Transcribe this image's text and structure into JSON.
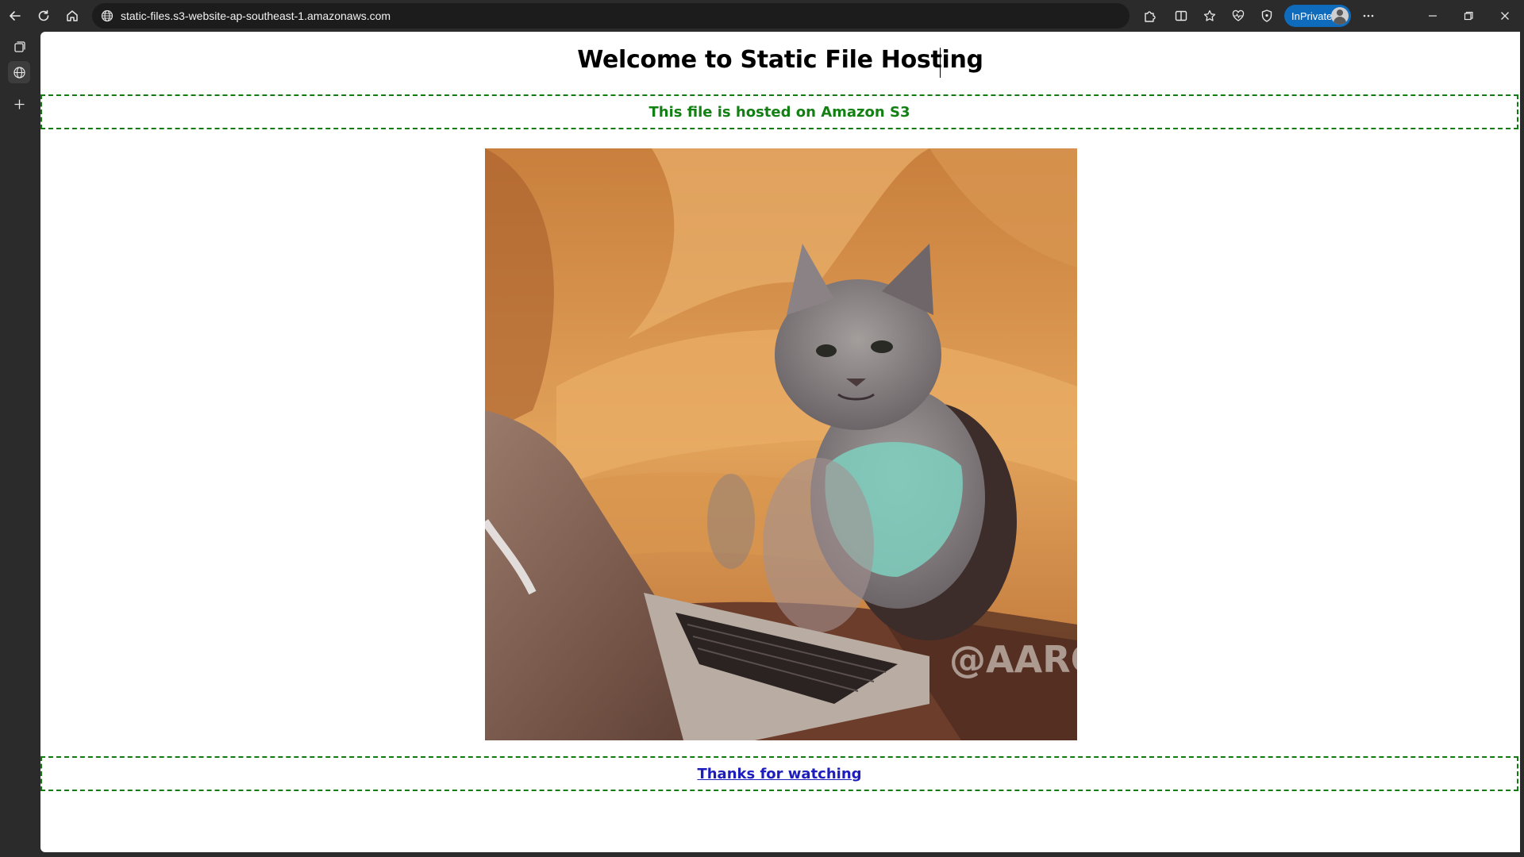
{
  "browser": {
    "url": "static-files.s3-website-ap-southeast-1.amazonaws.com",
    "inprivate_label": "InPrivate",
    "icons": {
      "back": "back-arrow-icon",
      "refresh": "refresh-icon",
      "home": "home-icon",
      "site_info": "globe-icon",
      "extensions": "puzzle-icon",
      "split_screen": "split-screen-icon",
      "favorites": "star-icon",
      "health": "heart-pulse-icon",
      "security": "shield-icon",
      "more": "ellipsis-icon",
      "minimize": "minimize-icon",
      "restore": "restore-icon",
      "close": "close-icon"
    }
  },
  "sidebar": {
    "icons": [
      "tab-actions-icon",
      "globe-tab-icon",
      "new-tab-plus-icon"
    ]
  },
  "page": {
    "title": "Welcome to Static File Hosting",
    "hosted_message": "This file is hosted on Amazon S3",
    "image_watermark": "@AARON",
    "footer_link": "Thanks for watching"
  },
  "colors": {
    "banner_border": "#117a11",
    "hosted_text": "#138013",
    "link": "#1d1dbd",
    "inprivate_badge": "#0f6cbd"
  }
}
